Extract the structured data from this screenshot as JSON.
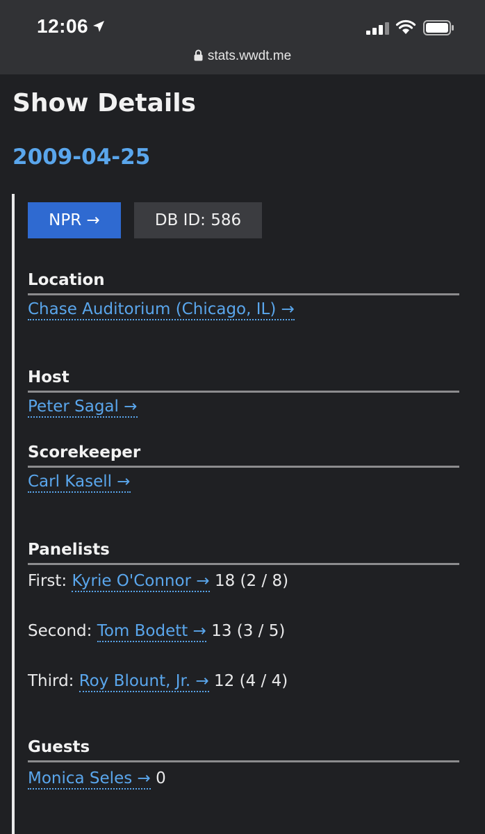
{
  "status_bar": {
    "time": "12:06",
    "url": "stats.wwdt.me"
  },
  "page": {
    "title": "Show Details",
    "show_date": "2009-04-25"
  },
  "badges": {
    "npr_label": "NPR →",
    "db_id_label": "DB ID: 586"
  },
  "location": {
    "heading": "Location",
    "link": "Chase Auditorium (Chicago, IL) →"
  },
  "host": {
    "heading": "Host",
    "link": "Peter Sagal →"
  },
  "scorekeeper": {
    "heading": "Scorekeeper",
    "link": "Carl Kasell →"
  },
  "panelists": {
    "heading": "Panelists",
    "items": [
      {
        "position": "First:",
        "name": "Kyrie O'Connor →",
        "score": "18 (2 / 8)"
      },
      {
        "position": "Second:",
        "name": "Tom Bodett →",
        "score": "13 (3 / 5)"
      },
      {
        "position": "Third:",
        "name": "Roy Blount, Jr. →",
        "score": "12 (4 / 4)"
      }
    ]
  },
  "guests": {
    "heading": "Guests",
    "items": [
      {
        "name": "Monica Seles →",
        "score": "0"
      }
    ]
  },
  "colors": {
    "background": "#1f2023",
    "link": "#5aa6ec",
    "npr_button": "#2f6ad1",
    "badge": "#3b3c40"
  }
}
